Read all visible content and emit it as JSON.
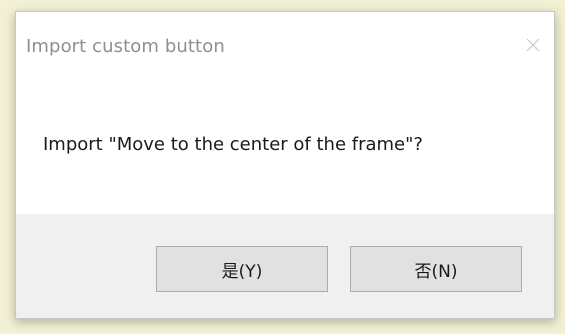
{
  "dialog": {
    "title": "Import custom button",
    "close_icon": "close-icon",
    "message": "Import \"Move to the center of the frame\"?",
    "buttons": {
      "yes_label": "是(Y)",
      "no_label": "否(N)"
    }
  },
  "colors": {
    "backdrop": "#f3f1d4",
    "title_text": "#8f8f8f",
    "footer_bg": "#f0f0f0",
    "button_bg": "#e1e1e1",
    "button_border": "#adadad"
  }
}
